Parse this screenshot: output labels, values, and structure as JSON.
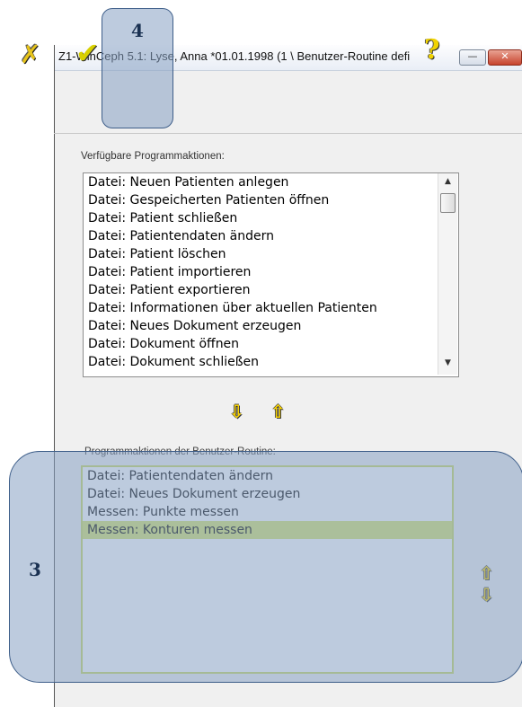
{
  "window": {
    "title": "Z1-WinCeph 5.1: Lyse, Anna *01.01.1998 (1 \\ Benutzer-Routine defi",
    "min_label": "—",
    "close_label": "✕"
  },
  "toolbar": {
    "cancel_icon": "x-icon",
    "ok_icon": "check-icon",
    "help_icon": "question-icon",
    "cancel_glyph": "✗",
    "ok_glyph": "✔",
    "help_glyph": "?"
  },
  "available": {
    "label": "Verfügbare Programmaktionen:",
    "items": [
      "Datei: Neuen Patienten anlegen",
      "Datei: Gespeicherten Patienten öffnen",
      "Datei: Patient schließen",
      "Datei: Patientendaten ändern",
      "Datei: Patient löschen",
      "Datei: Patient importieren",
      "Datei: Patient exportieren",
      "Datei: Informationen über aktuellen Patienten",
      "Datei: Neues Dokument erzeugen",
      "Datei: Dokument öffnen",
      "Datei: Dokument schließen"
    ]
  },
  "move": {
    "down_glyph": "⇩",
    "up_glyph": "⇧"
  },
  "routine": {
    "label": "Programmaktionen der Benutzer-Routine:",
    "items": [
      "Datei: Patientendaten ändern",
      "Datei: Neues Dokument erzeugen",
      "Messen: Punkte messen",
      "Messen: Konturen messen"
    ],
    "selected_index": 3
  },
  "callouts": {
    "three": "3",
    "four": "4"
  },
  "colors": {
    "callout_fill": "#87a0c3",
    "selection": "#d7e46b",
    "accent_yellow": "#ffd800"
  }
}
